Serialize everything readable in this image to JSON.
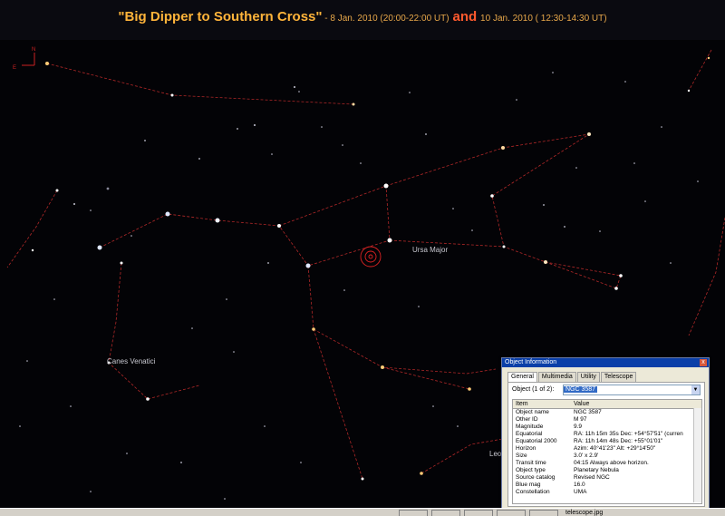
{
  "title": {
    "main": "\"Big Dipper to Southern Cross\"",
    "sep": " - ",
    "date1": "8 Jan. 2010 (20:00-22:00 UT)",
    "and": "and",
    "date2": "10 Jan. 2010 ( 12:30-14:30 UT)"
  },
  "compass": {
    "north": "N",
    "east": "E"
  },
  "constellation_labels": [
    "Ursa Major",
    "Canes Venatici",
    "Leo"
  ],
  "colors": {
    "constellation_line": "#b02828",
    "title": "#ffb43a",
    "and": "#ff5a2e",
    "selection": "#316ac5"
  },
  "object_window": {
    "caption": "Object Information",
    "close": "x",
    "tabs": [
      "General",
      "Multimedia",
      "Utility",
      "Telescope"
    ],
    "object_label": "Object (1 of 2):",
    "selected_object": "NGC 3587",
    "columns": [
      "Item",
      "Value"
    ],
    "rows": [
      {
        "item": "Object name",
        "value": "NGC 3587"
      },
      {
        "item": "Other ID",
        "value": "M 97"
      },
      {
        "item": "Magnitude",
        "value": "9.9"
      },
      {
        "item": "Equatorial",
        "value": "RA: 11h 15m 35s  Dec: +54°57'51\" (curren"
      },
      {
        "item": "Equatorial 2000",
        "value": "RA: 11h 14m 48s  Dec: +55°01'01\""
      },
      {
        "item": "Horizon",
        "value": "Azim: 40°41'23\"  Alt: +29°14'50\""
      },
      {
        "item": "Size",
        "value": "3.0' x 2.9'"
      },
      {
        "item": "Transit time",
        "value": "04:15  Always above horizon."
      },
      {
        "item": "Object type",
        "value": "Planetary Nebula"
      },
      {
        "item": "Source catalog",
        "value": "Revised NGC"
      },
      {
        "item": "Blue mag",
        "value": "16.0"
      },
      {
        "item": "Constellation",
        "value": "UMA"
      }
    ]
  },
  "taskbar": {
    "label": "telescope.jpg"
  }
}
